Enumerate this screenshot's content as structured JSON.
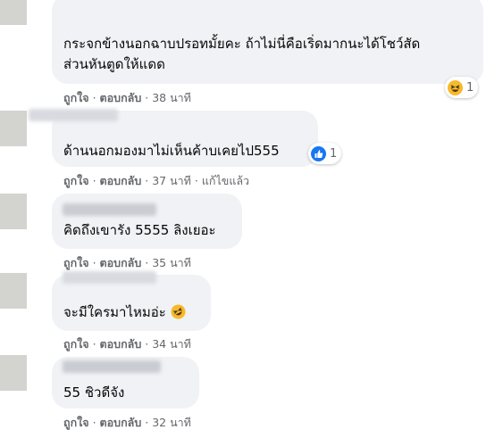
{
  "comments": [
    {
      "text_lines": [
        "กระจกข้างนอกฉาบปรอทมั้ยคะ ถ้าไม่นี่คือเริ่ดมากนะได้โชว์สัด",
        "ส่วนหันตูดให้แดด"
      ],
      "actions": {
        "like": "ถูกใจ",
        "reply": "ตอบกลับ",
        "time": "38 นาที",
        "edited": ""
      },
      "reaction": {
        "icon": "haha-icon",
        "count": "1"
      }
    },
    {
      "text_lines": [
        "ด้านนอกมองมาไม่เห็นค้าบเคยไป555"
      ],
      "actions": {
        "like": "ถูกใจ",
        "reply": "ตอบกลับ",
        "time": "37 นาที",
        "edited": "แก้ไขแล้ว"
      },
      "reaction": {
        "icon": "like-icon",
        "count": "1"
      }
    },
    {
      "text_lines": [
        "คิดถึงเขารัง 5555 ลิงเยอะ"
      ],
      "actions": {
        "like": "ถูกใจ",
        "reply": "ตอบกลับ",
        "time": "35 นาที",
        "edited": ""
      }
    },
    {
      "text_lines": [
        "จะมีใครมาไหมอ่ะ"
      ],
      "emoji": "rofl-emoji",
      "actions": {
        "like": "ถูกใจ",
        "reply": "ตอบกลับ",
        "time": "34 นาที",
        "edited": ""
      }
    },
    {
      "text_lines": [
        "55 ชิวดีจัง"
      ],
      "actions": {
        "like": "ถูกใจ",
        "reply": "ตอบกลับ",
        "time": "32 นาที",
        "edited": ""
      }
    }
  ],
  "separator": "·",
  "colors": {
    "bubble": "#f0f2f5",
    "meta_text": "#65676b",
    "like_blue": "#1877f2",
    "emoji_yellow": "#f7b928"
  }
}
